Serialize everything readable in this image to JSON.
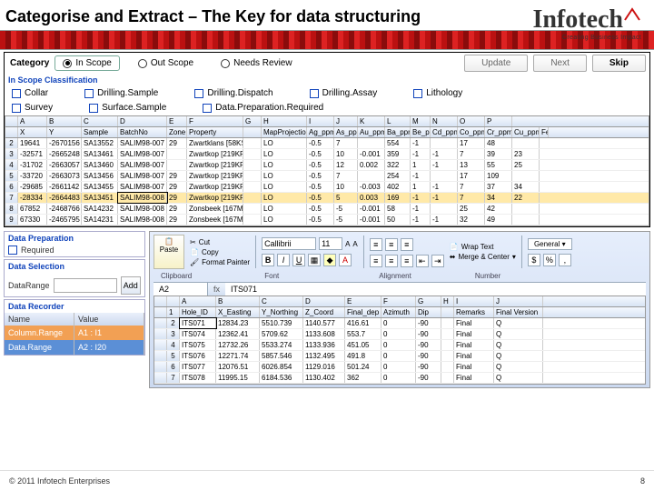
{
  "slide": {
    "title": "Categorise and Extract – The Key for data structuring",
    "footer_left": "© 2011 Infotech Enterprises",
    "footer_right": "8"
  },
  "logo": {
    "brand": "Infotech",
    "tag": "Creating Business Impact"
  },
  "category": {
    "label": "Category",
    "in_scope": "In Scope",
    "out_scope": "Out Scope",
    "needs_review": "Needs Review",
    "update": "Update",
    "next": "Next",
    "skip": "Skip"
  },
  "scope": {
    "label": "In Scope Classification",
    "row1": [
      "Collar",
      "Drilling.Sample",
      "Drilling.Dispatch",
      "Drilling.Assay",
      "Lithology"
    ],
    "row2": [
      "Survey",
      "Surface.Sample",
      "Data.Preparation.Required"
    ]
  },
  "grid1": {
    "letters": [
      "",
      "A",
      "B",
      "C",
      "D",
      "E",
      "F",
      "G",
      "H",
      "I",
      "J",
      "K",
      "L",
      "M",
      "N",
      "O",
      "P"
    ],
    "headers": [
      "",
      "X",
      "Y",
      "Sample",
      "BatchNo",
      "Zone",
      "Property",
      "",
      "MapProjection",
      "Ag_ppm",
      "As_ppm",
      "Au_ppm",
      "Ba_ppm",
      "Be_ppm",
      "Cd_ppm",
      "Co_ppm",
      "Cr_ppm",
      "Cu_ppm",
      "Fe"
    ],
    "rows": [
      [
        "2",
        "19641",
        "-2670156",
        "SA13552",
        "SALIM98-007",
        "29",
        "Zwartklans [58KS]",
        "",
        "LO",
        "-0.5",
        "7",
        "",
        "554",
        "-1",
        "",
        "17",
        "48",
        ""
      ],
      [
        "3",
        "-32571",
        "-2665248",
        "SA13461",
        "SALIM98-007",
        "",
        "Zwartkop [219KR]",
        "",
        "LO",
        "-0.5",
        "10",
        "-0.001",
        "359",
        "-1",
        "-1",
        "7",
        "39",
        "23"
      ],
      [
        "4",
        "-31702",
        "-2663057",
        "SA13460",
        "SALIM98-007",
        "",
        "Zwartkop [219KR]",
        "",
        "LO",
        "-0.5",
        "12",
        "0.002",
        "322",
        "1",
        "-1",
        "13",
        "55",
        "25"
      ],
      [
        "5",
        "-33720",
        "-2663073",
        "SA13456",
        "SALIM98-007",
        "29",
        "Zwartkop [219KR]",
        "",
        "LO",
        "-0.5",
        "7",
        "",
        "254",
        "-1",
        "",
        "17",
        "109",
        ""
      ],
      [
        "6",
        "-29685",
        "-2661142",
        "SA13455",
        "SALIM98-007",
        "29",
        "Zwartkop [219KR]",
        "",
        "LO",
        "-0.5",
        "10",
        "-0.003",
        "402",
        "1",
        "-1",
        "7",
        "37",
        "34"
      ],
      [
        "7",
        "-28334",
        "-2664483",
        "SA13451",
        "SALIM98-008",
        "29",
        "Zwartkop [219KR]",
        "",
        "LO",
        "-0.5",
        "5",
        "0.003",
        "169",
        "-1",
        "-1",
        "7",
        "34",
        "22"
      ],
      [
        "8",
        "67852",
        "-2468766",
        "SA14232",
        "SALIM98-008",
        "29",
        "Zonsbeek [167MS]",
        "",
        "LO",
        "-0.5",
        "-5",
        "-0.001",
        "58",
        "-1",
        "",
        "25",
        "42",
        ""
      ],
      [
        "9",
        "67330",
        "-2465795",
        "SA14231",
        "SALIM98-008",
        "29",
        "Zonsbeek [167MS]",
        "",
        "LO",
        "-0.5",
        "-5",
        "-0.001",
        "50",
        "-1",
        "-1",
        "32",
        "49",
        ""
      ]
    ]
  },
  "dataprep": {
    "label": "Data Preparation",
    "required": "Required"
  },
  "datasel": {
    "label": "Data Selection",
    "range_lbl": "DataRange",
    "btn": "Add"
  },
  "recorder": {
    "label": "Data Recorder",
    "h1": "Name",
    "h2": "Value",
    "r1n": "Column.Range",
    "r1v": "A1 : I1",
    "r2n": "Data.Range",
    "r2v": "A2 : I20"
  },
  "ribbon": {
    "paste": "Paste",
    "cut": "Cut",
    "copy": "Copy",
    "fp": "Format Painter",
    "font": "Callibrii",
    "size": "11",
    "wrap": "Wrap Text",
    "merge": "Merge & Center",
    "general": "General",
    "g1": "Clipboard",
    "g2": "Font",
    "g3": "Alignment",
    "g4": "Number",
    "cellref": "A2",
    "fx": "fx",
    "cellval": "ITS071"
  },
  "grid2": {
    "letters": [
      "",
      "",
      "A",
      "B",
      "C",
      "D",
      "E",
      "F",
      "G",
      "H",
      "I",
      "J"
    ],
    "headers": [
      "",
      "1",
      "Hole_ID",
      "X_Easting",
      "Y_Northing",
      "Z_Coord",
      "Final_dep",
      "Azimuth",
      "Dip",
      "",
      "Remarks",
      "Final Version"
    ],
    "rows": [
      [
        "",
        "2",
        "ITS071",
        "12834.23",
        "5510.739",
        "1140.577",
        "416.61",
        "0",
        "-90",
        "",
        "Final",
        "Q"
      ],
      [
        "",
        "3",
        "ITS074",
        "12362.41",
        "5709.62",
        "1133.608",
        "553.7",
        "0",
        "-90",
        "",
        "Final",
        "Q"
      ],
      [
        "",
        "4",
        "ITS075",
        "12732.26",
        "5533.274",
        "1133.936",
        "451.05",
        "0",
        "-90",
        "",
        "Final",
        "Q"
      ],
      [
        "",
        "5",
        "ITS076",
        "12271.74",
        "5857.546",
        "1132.495",
        "491.8",
        "0",
        "-90",
        "",
        "Final",
        "Q"
      ],
      [
        "",
        "6",
        "ITS077",
        "12076.51",
        "6026.854",
        "1129.016",
        "501.24",
        "0",
        "-90",
        "",
        "Final",
        "Q"
      ],
      [
        "",
        "7",
        "ITS078",
        "11995.15",
        "6184.536",
        "1130.402",
        "362",
        "0",
        "-90",
        "",
        "Final",
        "Q"
      ]
    ]
  }
}
